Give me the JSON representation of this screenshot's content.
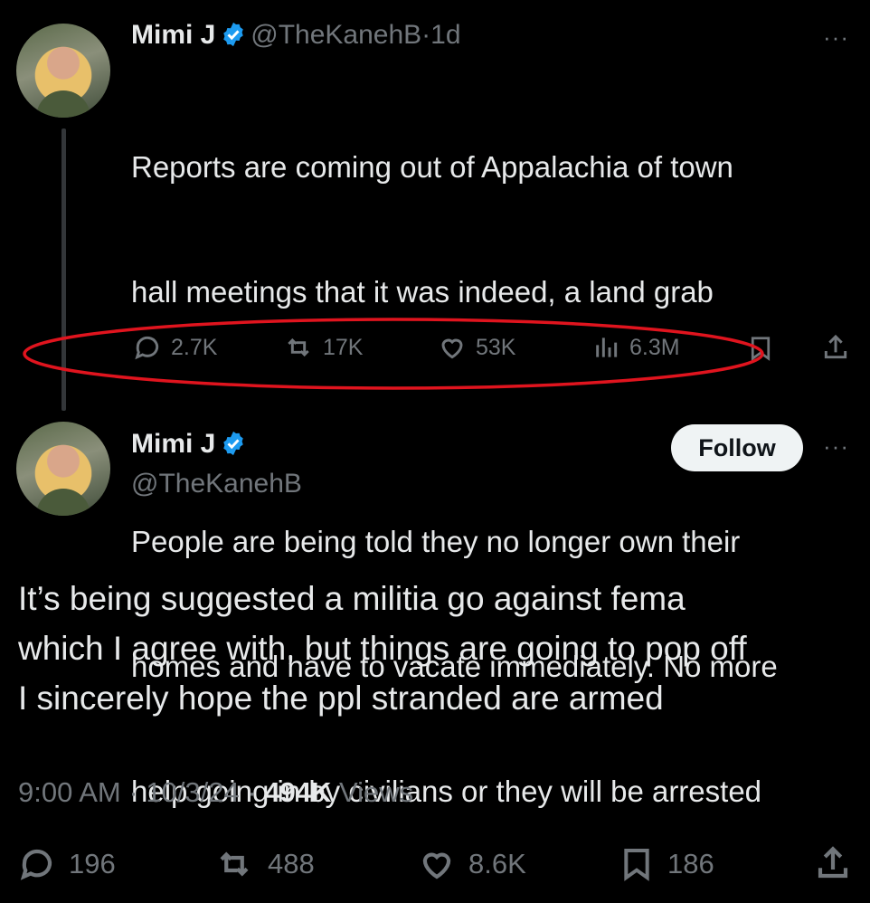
{
  "parent_tweet": {
    "author_name": "Mimi J",
    "handle": "@TheKanehB",
    "time": "1d",
    "separator": "·",
    "text_line1": "Reports are coming out of Appalachia of town",
    "text_line2": "hall meetings that it was indeed, a land grab",
    "text_line3": "People are being told they no longer own their",
    "text_line4": "homes and have to vacate immediately. No more",
    "text_line5": "help going in by civilians or they will be arrested",
    "replies": "2.7K",
    "reposts": "17K",
    "likes": "53K",
    "views": "6.3M"
  },
  "main_tweet": {
    "author_name": "Mimi J",
    "handle": "@TheKanehB",
    "follow_label": "Follow",
    "text_line1": "It’s being suggested a militia go against fema",
    "text_line2": "which I agree with, but things are going to pop off",
    "text_line3": "I sincerely hope the ppl stranded are armed",
    "time": "9:00 AM",
    "date": "10/3/24",
    "views_count": "494K",
    "views_label": "Views",
    "replies": "196",
    "reposts": "488",
    "likes": "8.6K",
    "bookmarks": "186"
  },
  "more_icon_text": "···",
  "colors": {
    "background": "#000000",
    "text": "#e7e9ea",
    "secondary": "#71767b",
    "verified": "#1d9bf0",
    "annotation_red": "#e0141e"
  }
}
